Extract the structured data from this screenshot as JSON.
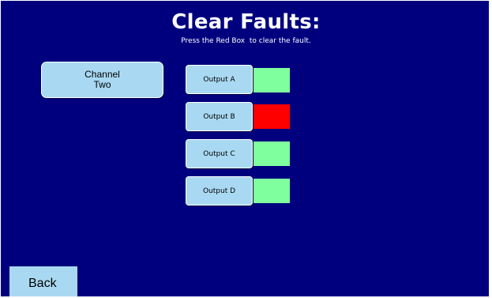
{
  "header": {
    "title": "Clear Faults:",
    "subtitle": "Press the Red Box  to clear the fault."
  },
  "channel": {
    "label": "Channel\nTwo"
  },
  "outputs": [
    {
      "label": "Output A",
      "status": "ok",
      "color": "#80ff9f"
    },
    {
      "label": "Output B",
      "status": "fault",
      "color": "#ff0000"
    },
    {
      "label": "Output C",
      "status": "ok",
      "color": "#80ff9f"
    },
    {
      "label": "Output D",
      "status": "ok",
      "color": "#80ff9f"
    }
  ],
  "footer": {
    "back_label": "Back"
  },
  "colors": {
    "background": "#00007f",
    "button": "#a9d9f2",
    "ok": "#80ff9f",
    "fault": "#ff0000"
  }
}
